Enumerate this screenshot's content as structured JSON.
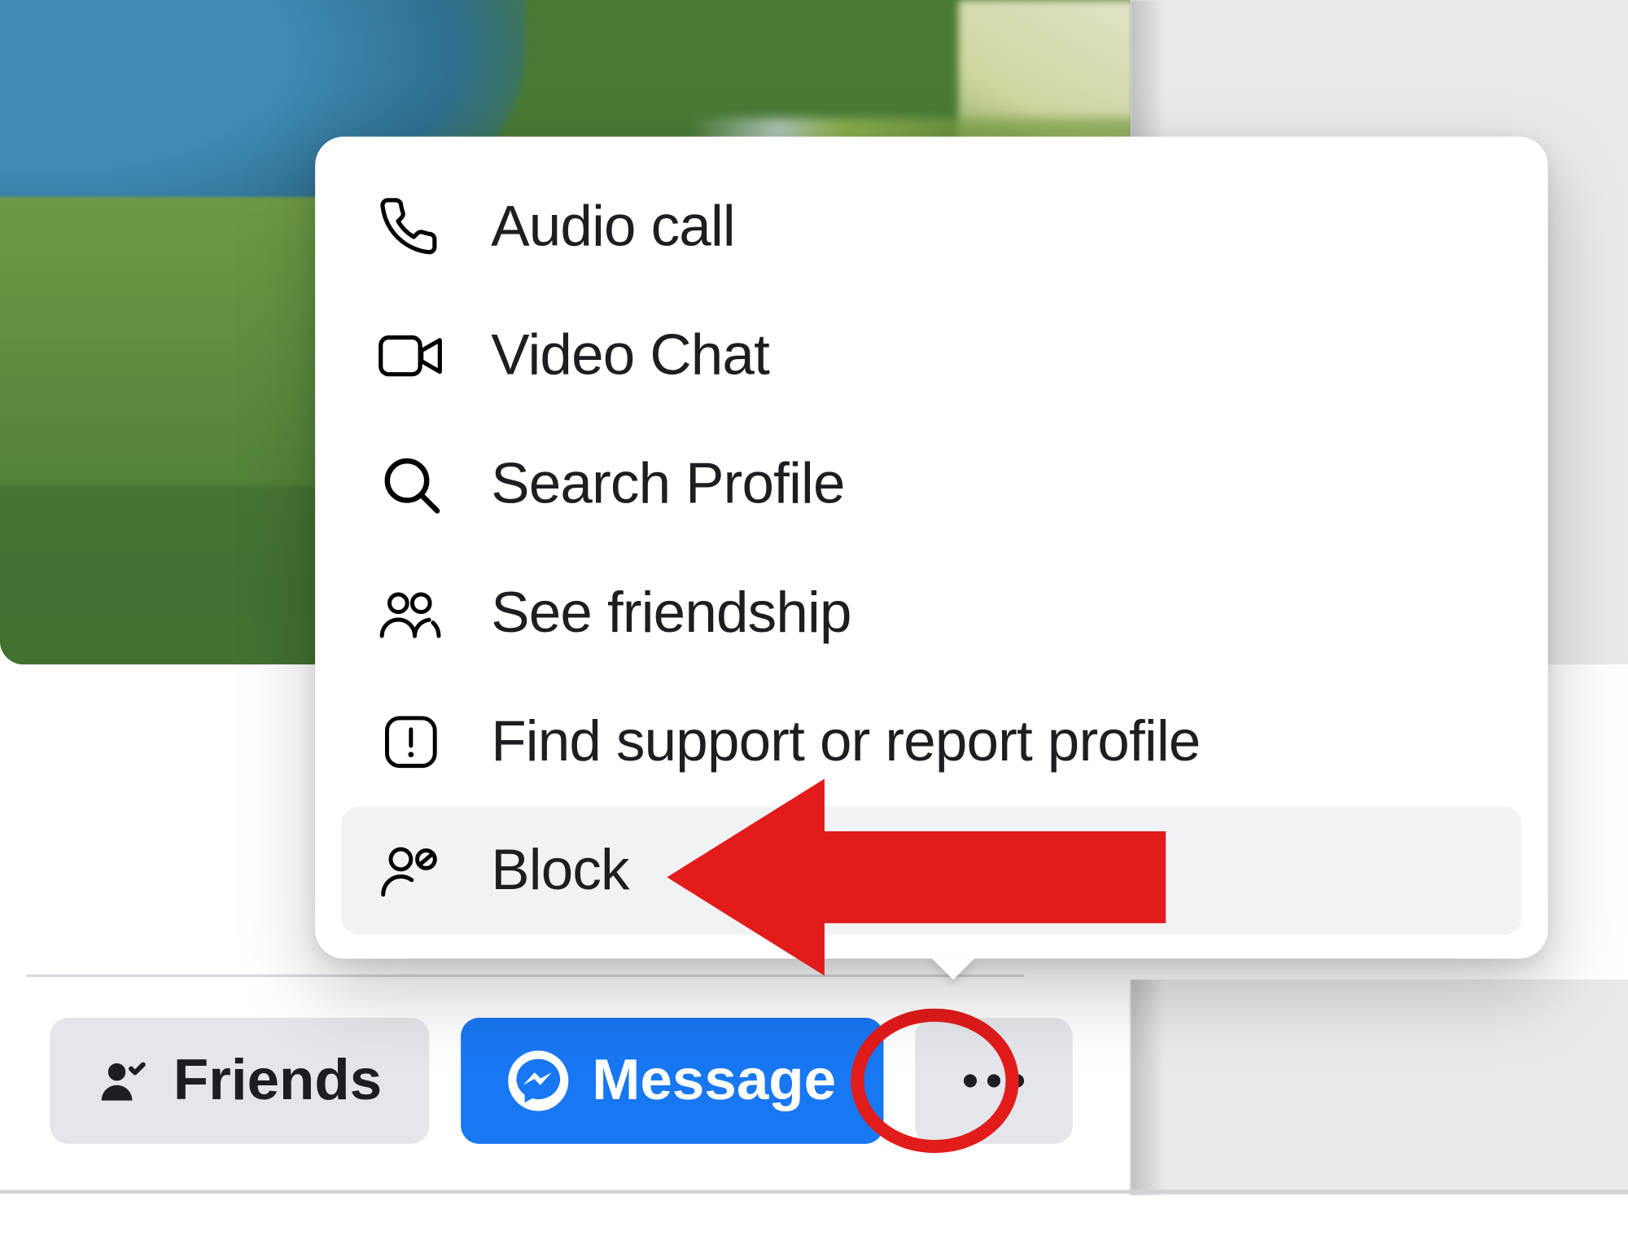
{
  "colors": {
    "primary": "#1877f2",
    "secondary_bg": "#e4e6eb",
    "text": "#1c1e21",
    "annotation_red": "#e21b1b"
  },
  "buttons": {
    "friends": {
      "label": "Friends",
      "icon": "friend-check-icon"
    },
    "message": {
      "label": "Message",
      "icon": "messenger-icon"
    },
    "more": {
      "aria": "More options",
      "icon": "ellipsis-icon"
    }
  },
  "menu": {
    "items": [
      {
        "id": "audio-call",
        "label": "Audio call",
        "icon": "phone-icon"
      },
      {
        "id": "video-chat",
        "label": "Video Chat",
        "icon": "video-camera-icon"
      },
      {
        "id": "search-profile",
        "label": "Search Profile",
        "icon": "search-icon"
      },
      {
        "id": "see-friendship",
        "label": "See friendship",
        "icon": "people-icon"
      },
      {
        "id": "report-profile",
        "label": "Find support or report profile",
        "icon": "report-icon"
      },
      {
        "id": "block",
        "label": "Block",
        "icon": "person-block-icon",
        "highlighted": true
      }
    ]
  },
  "annotations": {
    "arrow_points_to": "block",
    "circle_around": "more-button"
  }
}
